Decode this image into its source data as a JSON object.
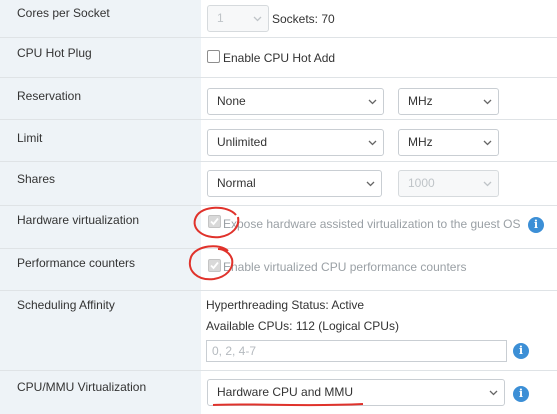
{
  "rows": {
    "cores": {
      "label": "Cores per Socket",
      "select_value": "1",
      "sockets_text": "Sockets: 70"
    },
    "hotplug": {
      "label": "CPU Hot Plug",
      "checkbox_label": "Enable CPU Hot Add",
      "checked": false
    },
    "reservation": {
      "label": "Reservation",
      "value": "None",
      "unit": "MHz"
    },
    "limit": {
      "label": "Limit",
      "value": "Unlimited",
      "unit": "MHz"
    },
    "shares": {
      "label": "Shares",
      "value": "Normal",
      "amount": "1000"
    },
    "hwvirt": {
      "label": "Hardware virtualization",
      "checkbox_label": "Expose hardware assisted virtualization to the guest OS",
      "checked": true,
      "disabled": true
    },
    "perfcounters": {
      "label": "Performance counters",
      "checkbox_label": "Enable virtualized CPU performance counters",
      "checked": true,
      "disabled": true
    },
    "affinity": {
      "label": "Scheduling Affinity",
      "ht_status": "Hyperthreading Status: Active",
      "available_cpus": "Available CPUs: 112 (Logical CPUs)",
      "placeholder": "0, 2, 4-7"
    },
    "mmu": {
      "label": "CPU/MMU Virtualization",
      "value": "Hardware CPU and MMU"
    }
  },
  "colors": {
    "label_bg": "#eef3f7",
    "info_icon": "#3c8fd6",
    "annotation": "#e0322b"
  }
}
